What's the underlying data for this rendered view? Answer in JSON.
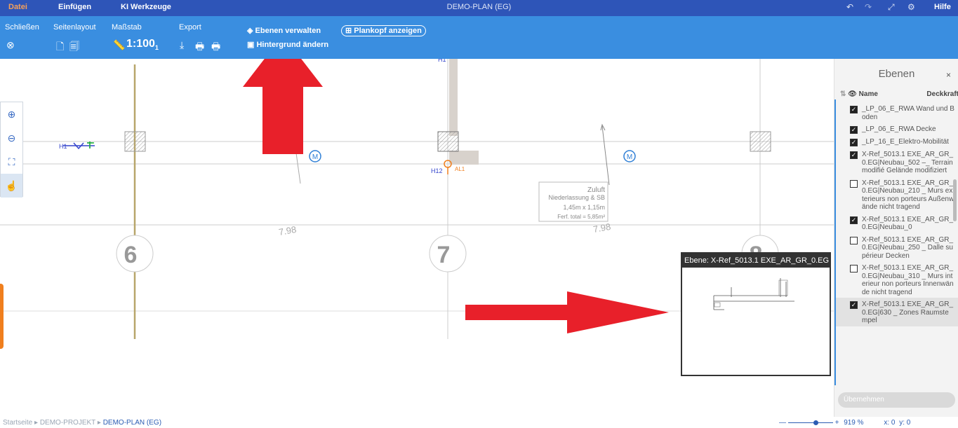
{
  "menu": {
    "items": [
      "Datei",
      "Einfügen",
      "KI Werkzeuge"
    ],
    "title": "DEMO-PLAN (EG)",
    "help": "Hilfe"
  },
  "toolbar": {
    "close": "Schließen",
    "page_layout": "Seitenlayout",
    "scale_label": "Maßstab",
    "scale_value": "1:100",
    "scale_sub": "1",
    "export": "Export",
    "layers_manage": "Ebenen verwalten",
    "background_change": "Hintergrund ändern",
    "title_block": "Plankopf anzeigen"
  },
  "drawing": {
    "axis_labels": [
      "6",
      "7",
      "8"
    ],
    "dimensions": [
      "7.98",
      "7.98"
    ],
    "markers": [
      "H1",
      "H1",
      "H12",
      "AL1",
      "M",
      "M"
    ],
    "annotation_lines": [
      "Zuluft",
      "Niederlassung & SB",
      "1,45m x 1,15m",
      "Ferf. total = 5,85m²"
    ]
  },
  "preview": {
    "title": "Ebene: X-Ref_5013.1 EXE_AR_GR_0.EG|..."
  },
  "layers_panel": {
    "title": "Ebenen",
    "col_name": "Name",
    "col_opacity": "Deckkraft",
    "apply": "Übernehmen",
    "items": [
      {
        "label": "_LP_06_E_RWA Wand und Boden",
        "checked": true
      },
      {
        "label": "_LP_06_E_RWA Decke",
        "checked": true
      },
      {
        "label": "_LP_16_E_Elektro-Mobilität",
        "checked": true
      },
      {
        "label": "X-Ref_5013.1 EXE_AR_GR_0.EG|Neubau_502 –_ Terrain modifié Gelände modifiziert",
        "checked": true
      },
      {
        "label": "X-Ref_5013.1 EXE_AR_GR_0.EG|Neubau_210 _ Murs exterieurs non porteurs Außenwände nicht tragend",
        "checked": false
      },
      {
        "label": "X-Ref_5013.1 EXE_AR_GR_0.EG|Neubau_0",
        "checked": true
      },
      {
        "label": "X-Ref_5013.1 EXE_AR_GR_0.EG|Neubau_250 _ Dalle supérieur Decken",
        "checked": false
      },
      {
        "label": "X-Ref_5013.1 EXE_AR_GR_0.EG|Neubau_310 _ Murs interieur non porteurs Innenwände nicht tragend",
        "checked": false
      },
      {
        "label": "X-Ref_5013.1 EXE_AR_GR_0.EG|630 _ Zones Raumstempel",
        "checked": true
      }
    ]
  },
  "statusbar": {
    "crumbs": [
      "Startseite",
      "DEMO-PROJEKT",
      "DEMO-PLAN (EG)"
    ],
    "zoom": "919 %",
    "x": "x: 0",
    "y": "y: 0"
  },
  "colors": {
    "menubar": "#2e55b8",
    "toolbar": "#3a8ee0",
    "arrow": "#e8202a",
    "accent": "#f07f1e"
  }
}
